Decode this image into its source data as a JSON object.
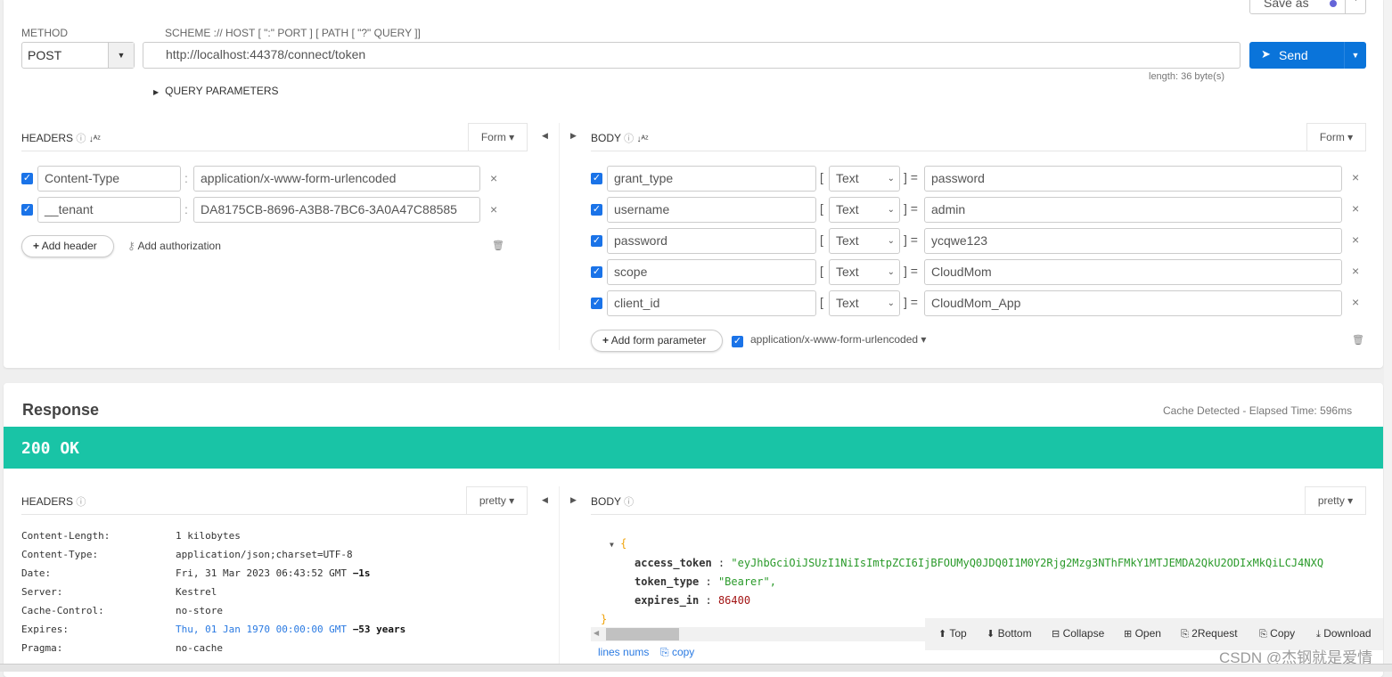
{
  "request": {
    "save_as": "Save as",
    "method_label": "METHOD",
    "method": "POST",
    "url_label": "SCHEME :// HOST [ \":\" PORT ] [ PATH [ \"?\" QUERY ]]",
    "url": "http://localhost:44378/connect/token",
    "length": "length: 36 byte(s)",
    "send": "Send",
    "query_params": "QUERY PARAMETERS",
    "headers_title": "HEADERS",
    "headers_mode": "Form",
    "headers": [
      {
        "name": "Content-Type",
        "value": "application/x-www-form-urlencoded"
      },
      {
        "name": "__tenant",
        "value": "DA8175CB-8696-A3B8-7BC6-3A0A47C88585"
      }
    ],
    "add_header": "Add header",
    "add_authorization": "Add authorization",
    "body_title": "BODY",
    "body_mode": "Form",
    "body": [
      {
        "name": "grant_type",
        "type": "Text",
        "value": "password"
      },
      {
        "name": "username",
        "type": "Text",
        "value": "admin"
      },
      {
        "name": "password",
        "type": "Text",
        "value": "ycqwe123"
      },
      {
        "name": "scope",
        "type": "Text",
        "value": "CloudMom"
      },
      {
        "name": "client_id",
        "type": "Text",
        "value": "CloudMom_App"
      }
    ],
    "add_form_param": "Add form parameter",
    "content_type": "application/x-www-form-urlencoded"
  },
  "response": {
    "title": "Response",
    "elapsed": "Cache Detected - Elapsed Time: 596ms",
    "status": "200 OK",
    "status_color": "#19c4a6",
    "headers_title": "HEADERS",
    "headers_mode": "pretty",
    "body_title": "BODY",
    "body_mode": "pretty",
    "headers": [
      {
        "k": "Content-Length:",
        "v": "1 kilobytes",
        "extra": ""
      },
      {
        "k": "Content-Type:",
        "v": "application/json;charset=UTF-8",
        "extra": ""
      },
      {
        "k": "Date:",
        "v": "Fri, 31 Mar 2023 06:43:52 GMT",
        "extra": "−1s"
      },
      {
        "k": "Server:",
        "v": "Kestrel",
        "extra": ""
      },
      {
        "k": "Cache-Control:",
        "v": "no-store",
        "extra": ""
      },
      {
        "k": "Expires:",
        "v": "Thu, 01 Jan 1970 00:00:00 GMT",
        "extra": "−53 years"
      },
      {
        "k": "Pragma:",
        "v": "no-cache",
        "extra": ""
      }
    ],
    "json": {
      "access_token_key": "access_token",
      "access_token": "\"eyJhbGciOiJSUzI1NiIsImtpZCI6IjBFOUMyQ0JDQ0I1M0Y2Rjg2Mzg3NThFMkY1MTJEMDA2QkU2ODIxMkQiLCJ4NXQ",
      "token_type_key": "token_type",
      "token_type": "\"Bearer\",",
      "expires_in_key": "expires_in",
      "expires_in": "86400"
    },
    "toolbar": [
      "Top",
      "Bottom",
      "Collapse",
      "Open",
      "2Request",
      "Copy",
      "Download"
    ],
    "lines_nums": "lines nums",
    "copy": "copy"
  },
  "watermark": "CSDN @杰钢就是爱情"
}
